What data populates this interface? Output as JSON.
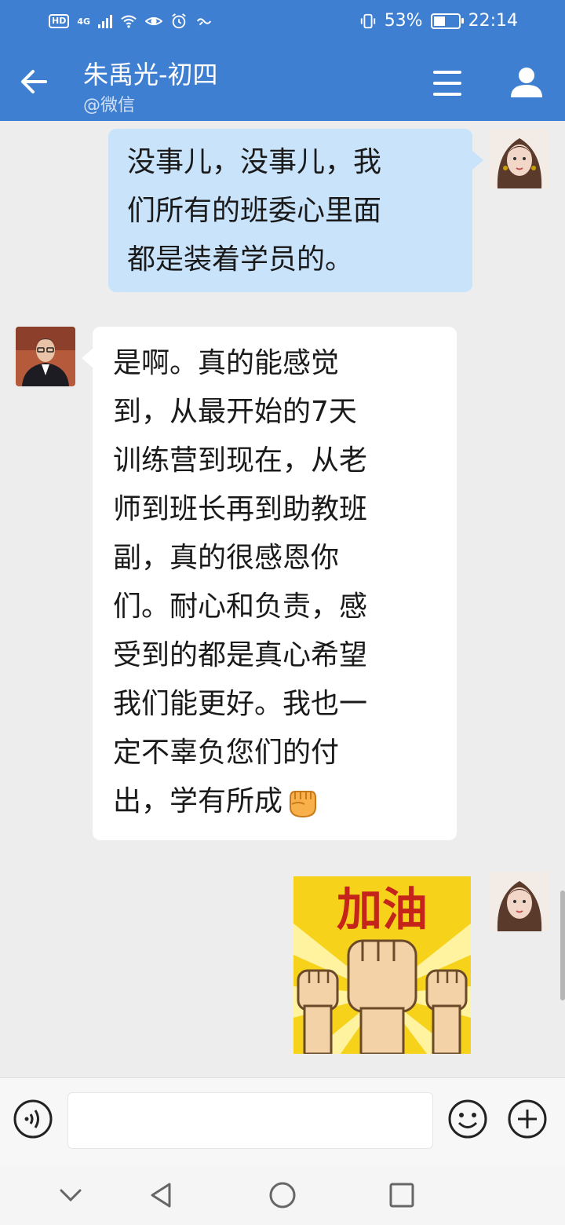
{
  "status_bar": {
    "hd": "HD",
    "network": "4G",
    "battery_percent": "53%",
    "battery_level": 0.53,
    "time": "22:14"
  },
  "header": {
    "title": "朱禹光-初四",
    "subtitle": "@微信",
    "icons": {
      "back": "back-arrow-icon",
      "menu": "menu-icon",
      "user": "user-icon"
    },
    "color": "#3f7fd1"
  },
  "messages": [
    {
      "side": "outgoing",
      "lines": [
        "没事儿，没事儿，我",
        "们所有的班委心里面",
        "都是装着学员的。"
      ],
      "bubble_color": "#c9e3fb"
    },
    {
      "side": "incoming",
      "lines": [
        "是啊。真的能感觉",
        "到，从最开始的7天",
        "训练营到现在，从老",
        "师到班长再到助教班",
        "副，真的很感恩你",
        "们。耐心和负责，感",
        "受到的都是真心希望",
        "我们能更好。我也一",
        "定不辜负您们的付",
        "出，学有所成"
      ],
      "emoji": "fist-emoji",
      "bubble_color": "#ffffff"
    },
    {
      "side": "outgoing",
      "type": "sticker",
      "sticker_text": "加油",
      "sticker": "fists-sticker"
    }
  ],
  "input_bar": {
    "voice_icon": "voice-icon",
    "emoji_icon": "smiley-icon",
    "add_icon": "plus-icon",
    "field_value": ""
  },
  "nav_bar": {
    "icons": [
      "chevron-down-icon",
      "back-triangle-icon",
      "home-circle-icon",
      "recents-square-icon"
    ]
  }
}
